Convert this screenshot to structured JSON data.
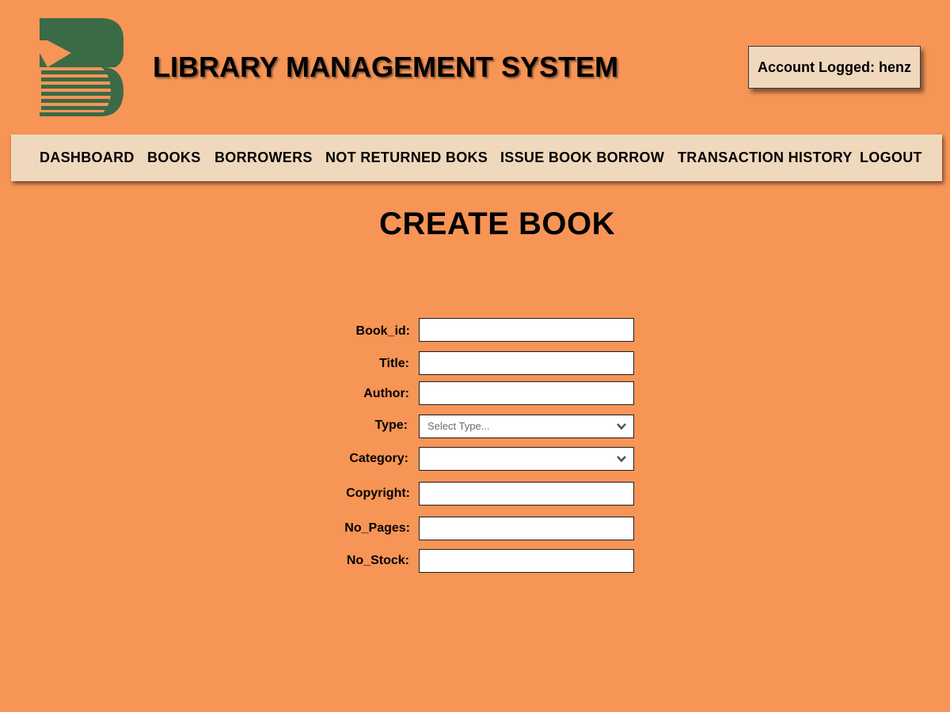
{
  "header": {
    "title": "LIBRARY MANAGEMENT SYSTEM",
    "account_label": "Account Logged: henz"
  },
  "colors": {
    "background": "#f69556",
    "panel": "#f0d8bd",
    "logo_green": "#3b6a47"
  },
  "nav": {
    "items": [
      {
        "label": "DASHBOARD"
      },
      {
        "label": "BOOKS"
      },
      {
        "label": "BORROWERS"
      },
      {
        "label": "NOT RETURNED BOKS"
      },
      {
        "label": "ISSUE BOOK BORROW"
      },
      {
        "label": "TRANSACTION HISTORY"
      },
      {
        "label": "LOGOUT"
      }
    ]
  },
  "page": {
    "heading": "CREATE BOOK"
  },
  "form": {
    "book_id": {
      "label": "Book_id:",
      "value": ""
    },
    "title": {
      "label": "Title:",
      "value": ""
    },
    "author": {
      "label": "Author:",
      "value": ""
    },
    "type": {
      "label": "Type:",
      "selected": "Select Type..."
    },
    "category": {
      "label": "Category:",
      "selected": ""
    },
    "copyright": {
      "label": "Copyright:",
      "value": ""
    },
    "no_pages": {
      "label": "No_Pages:",
      "value": ""
    },
    "no_stock": {
      "label": "No_Stock:",
      "value": ""
    }
  },
  "icons": [
    "library-logo-icon",
    "chevron-down-icon"
  ]
}
